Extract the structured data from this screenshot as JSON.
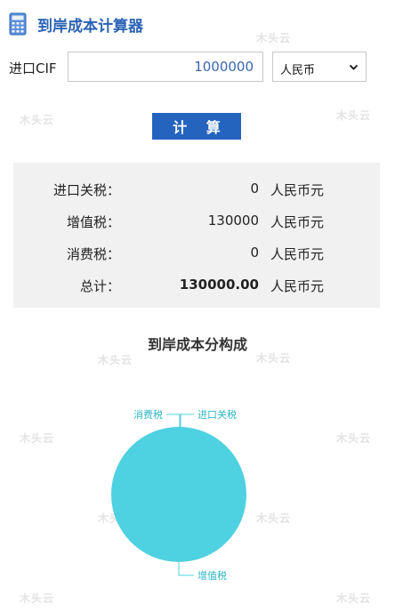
{
  "header": {
    "title": "到岸成本计算器"
  },
  "form": {
    "cif_label": "进口CIF",
    "cif_value": "1000000",
    "currency_selected": "人民币"
  },
  "actions": {
    "calculate_label": "计 算"
  },
  "results": {
    "rows": [
      {
        "label": "进口关税：",
        "value": "0",
        "unit": "人民币元"
      },
      {
        "label": "增值税：",
        "value": "130000",
        "unit": "人民币元"
      },
      {
        "label": "消费税：",
        "value": "0",
        "unit": "人民币元"
      },
      {
        "label": "总计：",
        "value": "130000.00",
        "unit": "人民币元"
      }
    ]
  },
  "watermark": "木头云",
  "colors": {
    "accent": "#2464bf",
    "title": "#2b63b6",
    "pie": "#4ed1e1",
    "panel": "#f1f1f1"
  },
  "chart_data": {
    "type": "pie",
    "title": "到岸成本分构成",
    "labels": [
      "消费税",
      "进口关税",
      "增值税"
    ],
    "values": [
      0,
      0,
      130000
    ],
    "colors": [
      "#4ed1e1",
      "#4ed1e1",
      "#4ed1e1"
    ]
  }
}
